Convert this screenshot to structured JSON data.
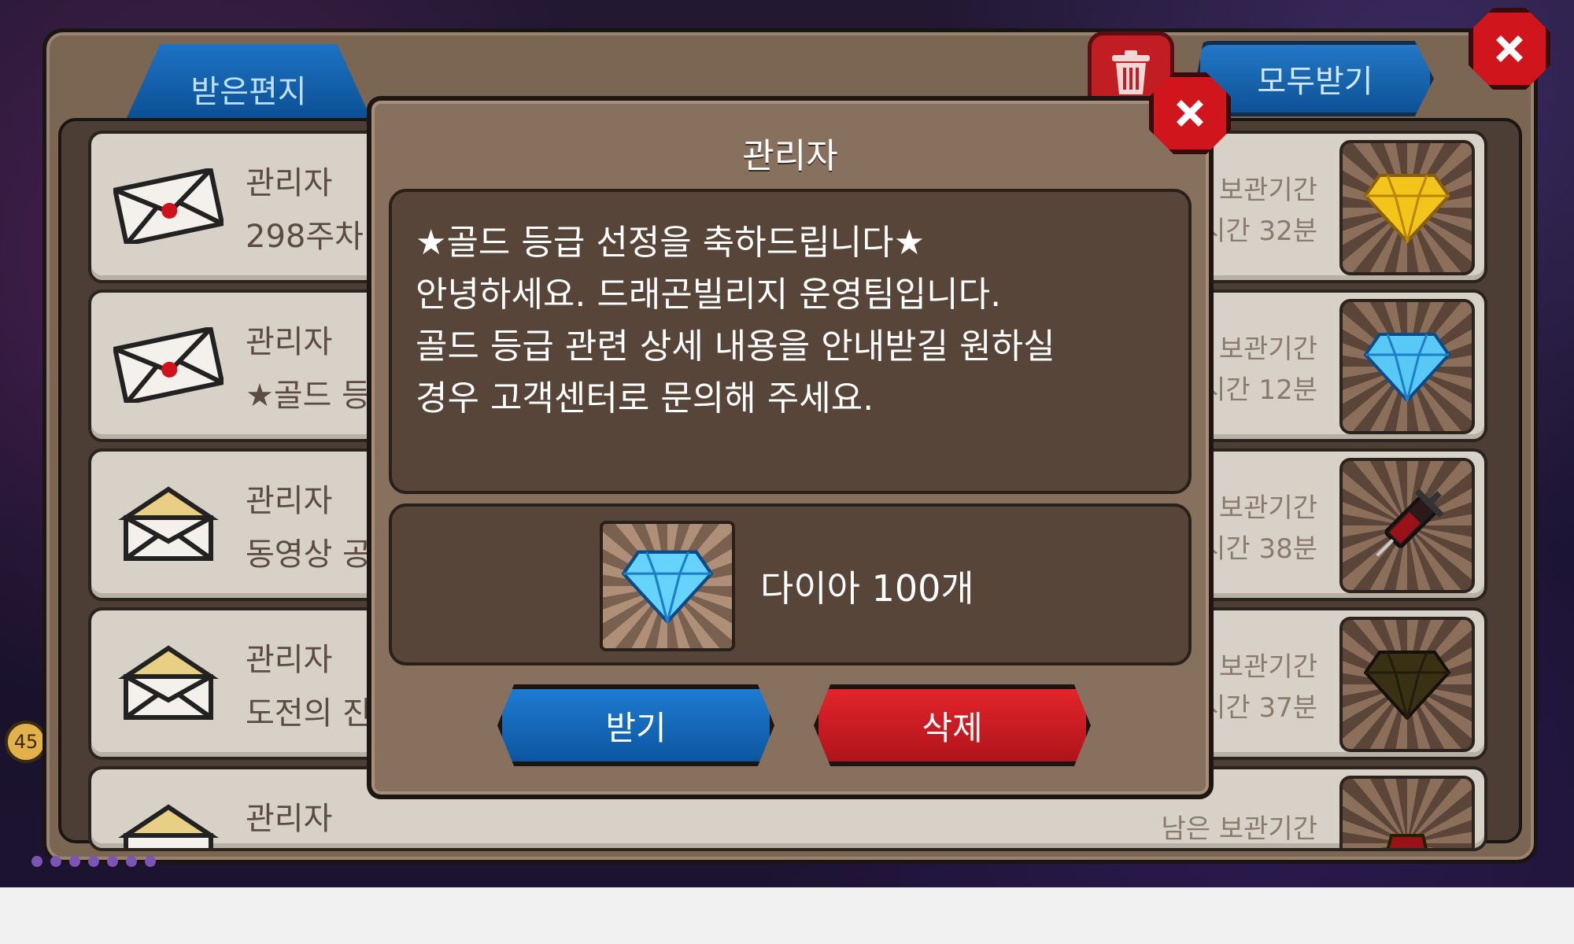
{
  "inbox": {
    "tab_label": "받은편지",
    "receive_all_label": "모두받기",
    "mails": [
      {
        "sender": "관리자",
        "subject": "298주차",
        "remain_label": "보관기간",
        "remain_time": "시간 32분",
        "item_icon": "gold-diamond-icon",
        "opened": false
      },
      {
        "sender": "관리자",
        "subject": "★골드 등",
        "remain_label": "보관기간",
        "remain_time": "시간 12분",
        "item_icon": "blue-diamond-icon",
        "opened": false
      },
      {
        "sender": "관리자",
        "subject": "동영상 공",
        "remain_label": "보관기간",
        "remain_time": "시간 38분",
        "item_icon": "syringe-icon",
        "opened": true
      },
      {
        "sender": "관리자",
        "subject": "도전의 진",
        "remain_label": "보관기간",
        "remain_time": "시간 37분",
        "item_icon": "dark-diamond-icon",
        "opened": true
      },
      {
        "sender": "관리자",
        "subject": "",
        "remain_label": "남은 보관기간",
        "remain_time": "",
        "item_icon": "potion-icon",
        "opened": true
      }
    ]
  },
  "dialog": {
    "title": "관리자",
    "message_lines": [
      "★골드 등급 선정을 축하드립니다★",
      "안녕하세요. 드래곤빌리지 운영팀입니다.",
      "골드 등급 관련 상세 내용을 안내받길 원하실",
      "경우 고객센터로 문의해 주세요."
    ],
    "reward_label": "다이아 100개",
    "receive_label": "받기",
    "delete_label": "삭제"
  },
  "side": {
    "level_badge": "45"
  },
  "colors": {
    "blue_button": "#0c56a0",
    "red_button": "#d1151c",
    "panel": "#7b6553",
    "dialog": "#88705f",
    "message_box": "#564538"
  }
}
